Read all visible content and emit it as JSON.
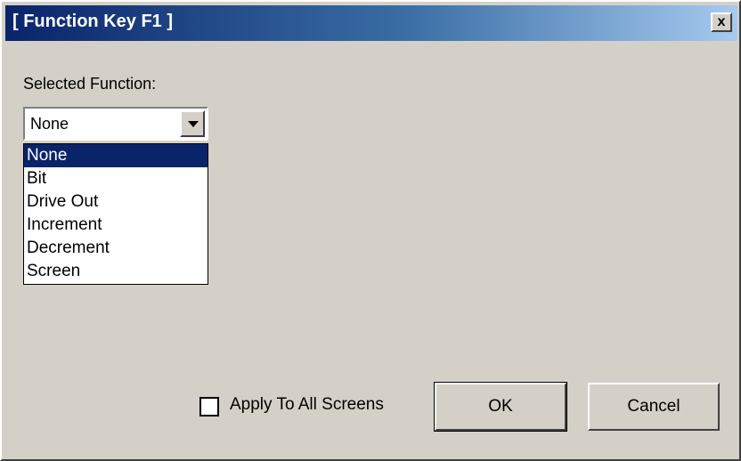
{
  "window": {
    "title": "[ Function Key F1 ]",
    "close_label": "x"
  },
  "selected_function": {
    "label": "Selected Function:",
    "value": "None",
    "options": [
      "None",
      "Bit",
      "Drive Out",
      "Increment",
      "Decrement",
      "Screen"
    ],
    "highlighted": "None"
  },
  "apply_all": {
    "label": "Apply To All Screens",
    "checked": false
  },
  "buttons": {
    "ok": "OK",
    "cancel": "Cancel"
  },
  "colors": {
    "titlebar_start": "#0a246a",
    "titlebar_end": "#a6caf0",
    "face": "#d4d0c8",
    "highlight": "#0a246a"
  }
}
